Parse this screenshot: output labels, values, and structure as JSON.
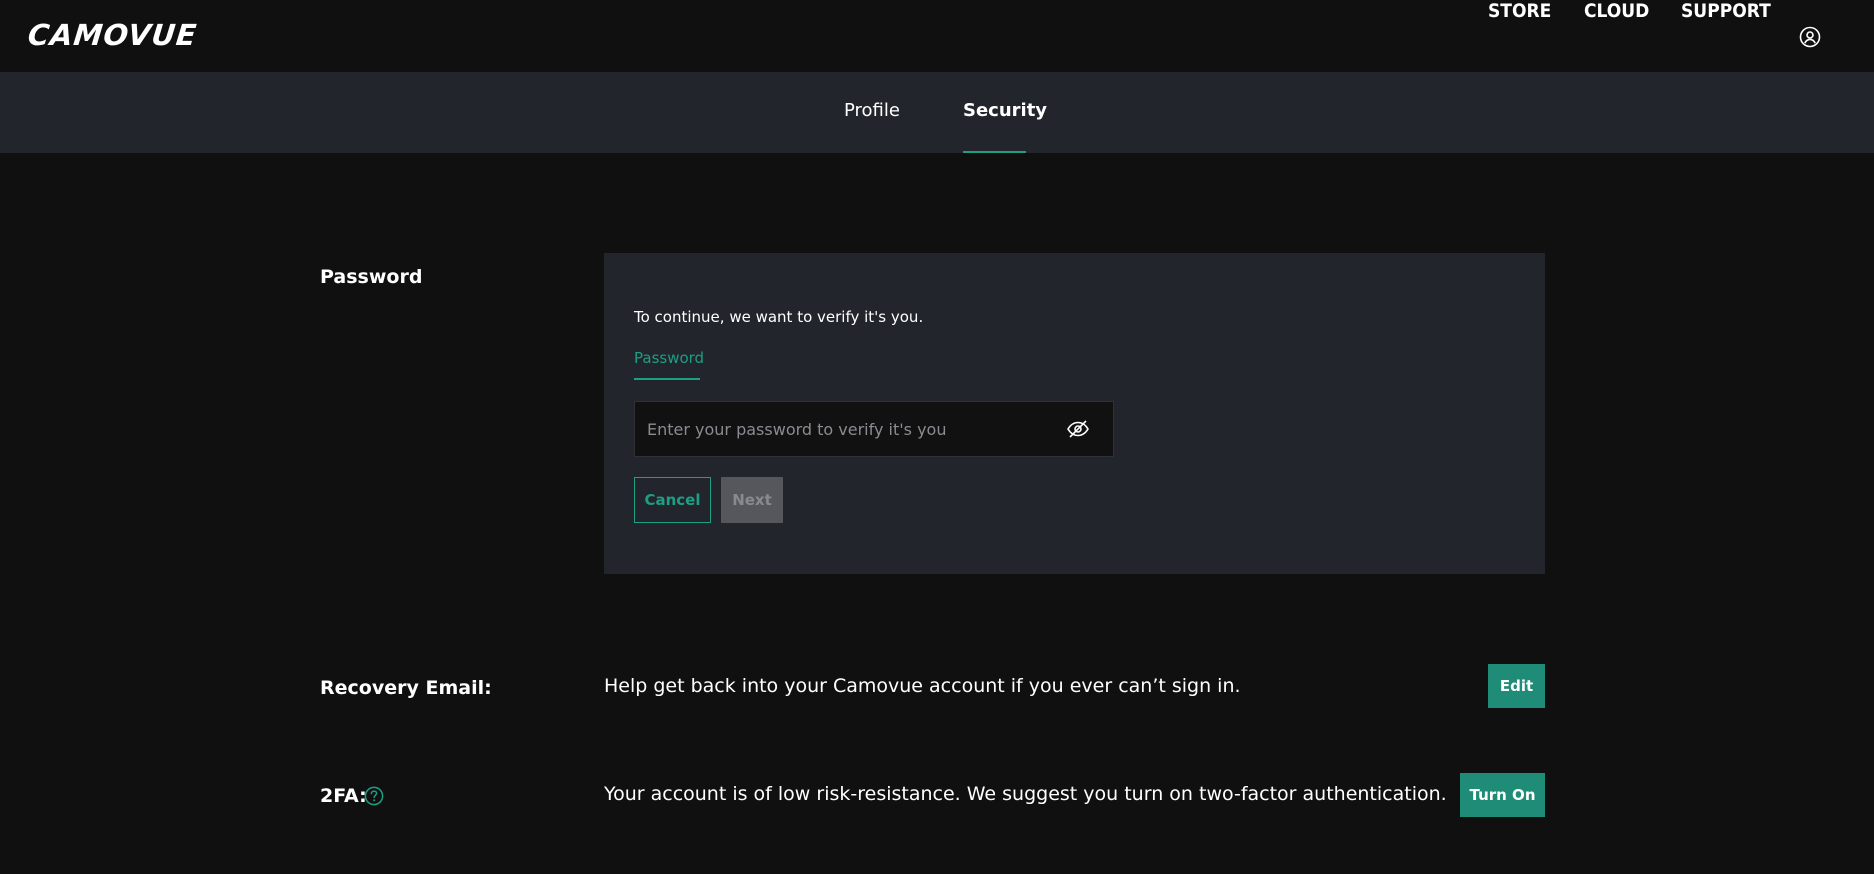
{
  "header": {
    "logo": "CAMOVUE",
    "nav": {
      "store": "STORE",
      "cloud": "CLOUD",
      "support": "SUPPORT"
    }
  },
  "tabs": {
    "profile": "Profile",
    "security": "Security",
    "active": "Security"
  },
  "password_section": {
    "label": "Password",
    "intro": "To continue, we want to verify it's you.",
    "field_tab": "Password",
    "input_value": "",
    "input_placeholder": "Enter your password to verify it's you",
    "cancel_label": "Cancel",
    "next_label": "Next"
  },
  "recovery_section": {
    "label": "Recovery Email:",
    "text": "Help get back into your Camovue account if you ever can’t sign in.",
    "button_label": "Edit"
  },
  "twofa_section": {
    "label": "2FA:",
    "text": "Your account is of low risk-resistance. We suggest you turn on two-factor authentication.",
    "button_label": "Turn On"
  },
  "icons": {
    "user": "user-account-icon",
    "eye": "eye-hidden-icon",
    "help": "help-circle-icon"
  },
  "colors": {
    "accent": "#1e9e83",
    "button_fill": "#1e8c76",
    "background": "#101011",
    "panel": "#23252c",
    "disabled_button": "#55575c"
  }
}
